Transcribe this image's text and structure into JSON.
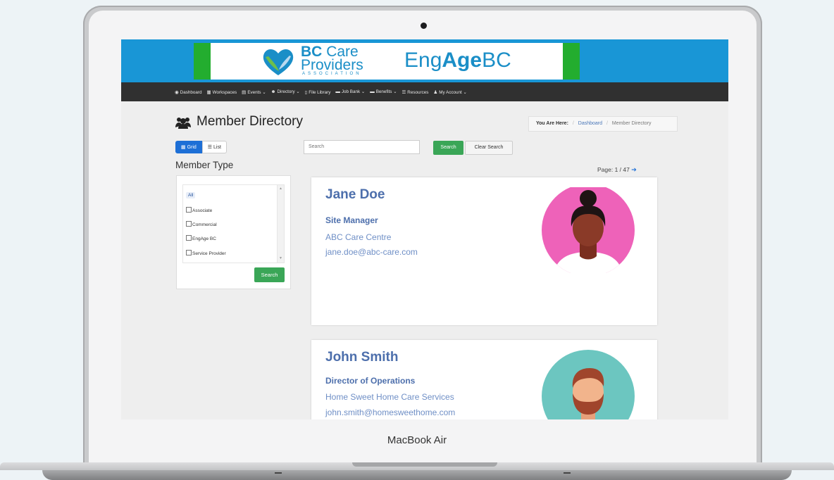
{
  "device": {
    "label": "MacBook Air"
  },
  "header": {
    "org_name_bold": "BC",
    "org_name_rest": "Care",
    "org_name_line2": "Providers",
    "org_association": "ASSOCIATION",
    "engage_prefix": "Eng",
    "engage_mid": "Age",
    "engage_suffix": "BC",
    "colors": {
      "band": "#1996d6",
      "green": "#23ad2f",
      "brand": "#1a8ec7"
    }
  },
  "nav": {
    "items": [
      {
        "icon": "dashboard-icon",
        "label": "Dashboard"
      },
      {
        "icon": "workspaces-icon",
        "label": "Workspaces"
      },
      {
        "icon": "calendar-icon",
        "label": "Events ⌄"
      },
      {
        "icon": "users-icon",
        "label": "Directory ⌄"
      },
      {
        "icon": "file-icon",
        "label": "File Library"
      },
      {
        "icon": "briefcase-icon",
        "label": "Job Bank ⌄"
      },
      {
        "icon": "benefits-icon",
        "label": "Benefits ⌄"
      },
      {
        "icon": "list-icon",
        "label": "Resources"
      },
      {
        "icon": "user-icon",
        "label": "My Account ⌄"
      }
    ]
  },
  "page": {
    "title": "Member Directory",
    "breadcrumb": {
      "prefix": "You Are Here:",
      "sep": "/",
      "items": [
        "Dashboard",
        "Member Directory"
      ]
    }
  },
  "toolbar": {
    "grid_label": "Grid",
    "list_label": "List",
    "search_placeholder": "Search",
    "search_button": "Search",
    "clear_button": "Clear Search"
  },
  "filters": {
    "heading": "Member Type",
    "options": [
      "All",
      "Associate",
      "Commercial",
      "EngAge BC",
      "Service Provider"
    ],
    "search_button": "Search"
  },
  "pagination": {
    "label": "Page: 1 / 47"
  },
  "members": [
    {
      "name": "Jane Doe",
      "role": "Site Manager",
      "org": "ABC Care Centre",
      "email": "jane.doe@abc-care.com",
      "avatar_bg": "#ee62b9"
    },
    {
      "name": "John Smith",
      "role": "Director of Operations",
      "org": "Home Sweet Home Care Services",
      "email": "john.smith@homesweethome.com",
      "avatar_bg": "#6cc6c0"
    }
  ]
}
